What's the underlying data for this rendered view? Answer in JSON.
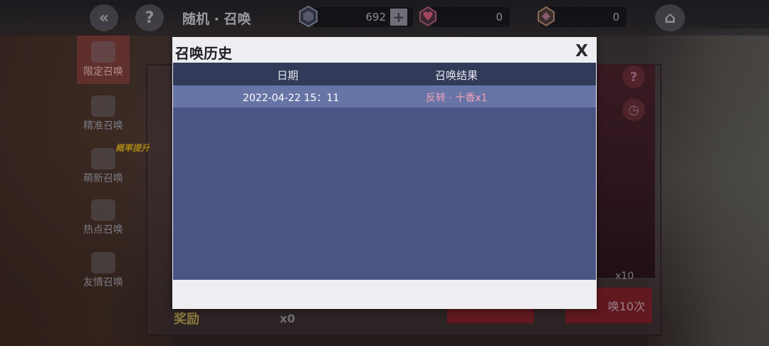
{
  "topbar": {
    "back_icon": "back-chevron-icon",
    "help_label": "?",
    "title": "随机 · 召唤",
    "resources": [
      {
        "name": "crystal",
        "icon": "crystal-icon",
        "value": "692"
      },
      {
        "name": "heart",
        "icon": "heart-gem-icon",
        "value": "0"
      },
      {
        "name": "coin",
        "icon": "coin-gem-icon",
        "value": "0"
      }
    ],
    "plus_label": "+",
    "home_icon": "home-icon"
  },
  "sidebar": {
    "items": [
      {
        "label": "限定召唤",
        "icon": "hexagon-icon",
        "active": true
      },
      {
        "label": "精准召唤",
        "icon": "card-icon",
        "active": false
      },
      {
        "label": "萌新召唤",
        "icon": "scroll-icon",
        "active": false
      },
      {
        "label": "热点召唤",
        "icon": "sword-icon",
        "active": false
      },
      {
        "label": "友情召唤",
        "icon": "heart-icon",
        "active": false
      }
    ],
    "promo": "概率提升"
  },
  "background_ui": {
    "reward_label": "奖励",
    "reward_count": "x0",
    "ticket_count": "x10",
    "ten_pull_label": "唤10次"
  },
  "modal": {
    "title": "召唤历史",
    "close_label": "X",
    "columns": [
      "日期",
      "召唤结果"
    ],
    "rows": [
      {
        "date": "2022-04-22 15：11",
        "result": "反转 · 十香x1"
      }
    ]
  },
  "colors": {
    "table_bg": "#4a5583",
    "header_bg": "#313a58",
    "row_bg": "#6774a6",
    "result_text": "#f3a3b8"
  }
}
